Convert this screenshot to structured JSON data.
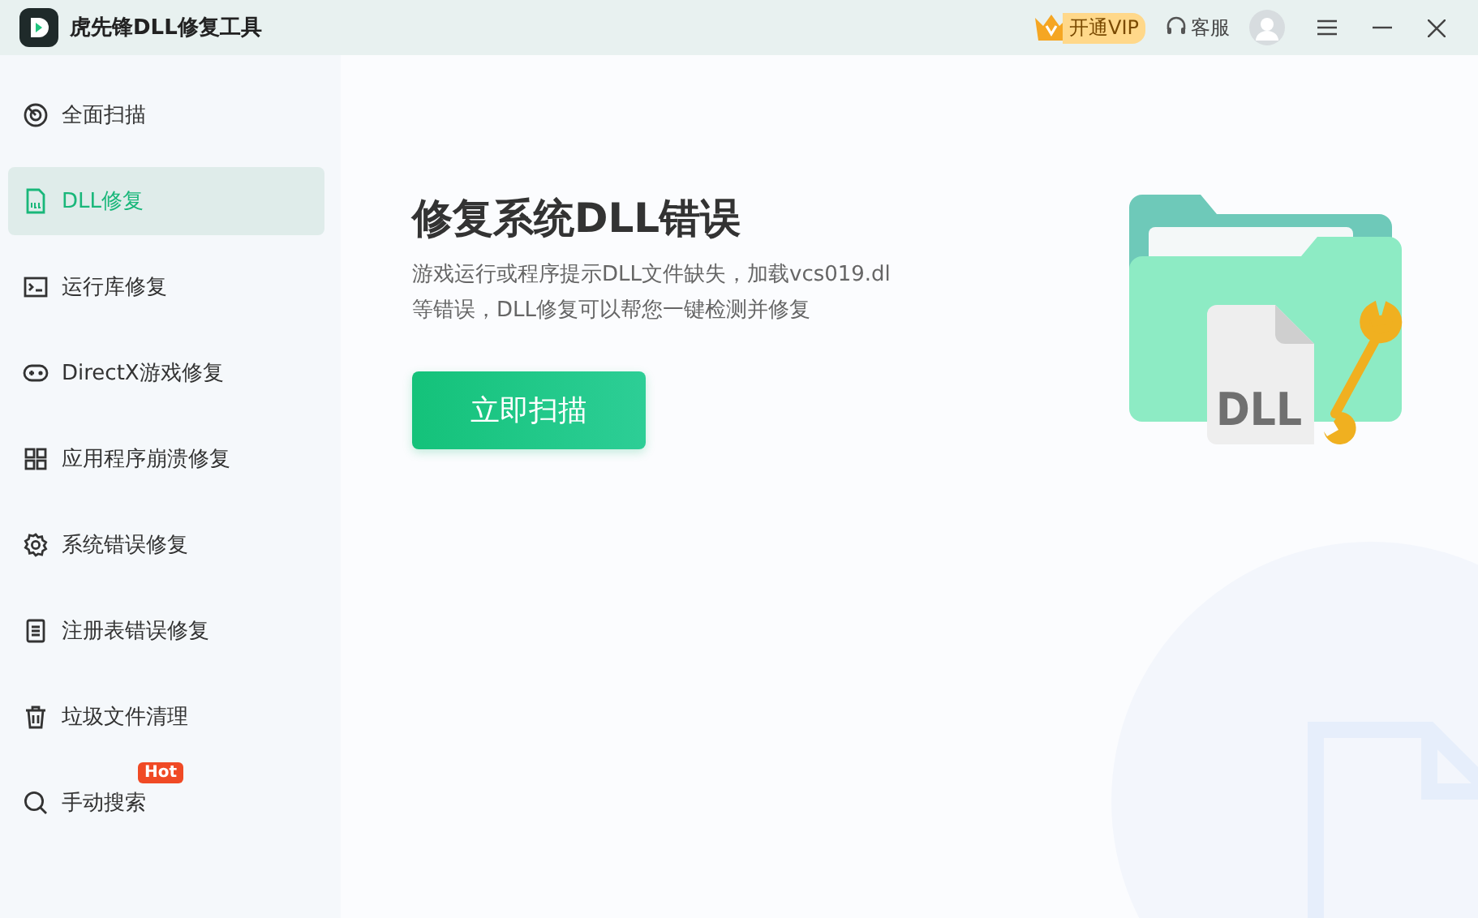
{
  "window": {
    "title": "虎先锋DLL修复工具"
  },
  "header": {
    "vip": "开通VIP",
    "service": "客服"
  },
  "sidebar": {
    "items": [
      {
        "label": "全面扫描",
        "selected": false
      },
      {
        "label": "DLL修复",
        "selected": true
      },
      {
        "label": "运行库修复",
        "selected": false
      },
      {
        "label": "DirectX游戏修复",
        "selected": false
      },
      {
        "label": "应用程序崩溃修复",
        "selected": false
      },
      {
        "label": "系统错误修复",
        "selected": false
      },
      {
        "label": "注册表错误修复",
        "selected": false
      },
      {
        "label": "垃圾文件清理",
        "selected": false
      },
      {
        "label": "手动搜索",
        "selected": false,
        "badge": "Hot"
      }
    ]
  },
  "main": {
    "title": "修复系统DLL错误",
    "description": "游戏运行或程序提示DLL文件缺失，加载vcs019.dl等错误，DLL修复可以帮您一键检测并修复",
    "button": "立即扫描",
    "illustration_label": "DLL"
  }
}
